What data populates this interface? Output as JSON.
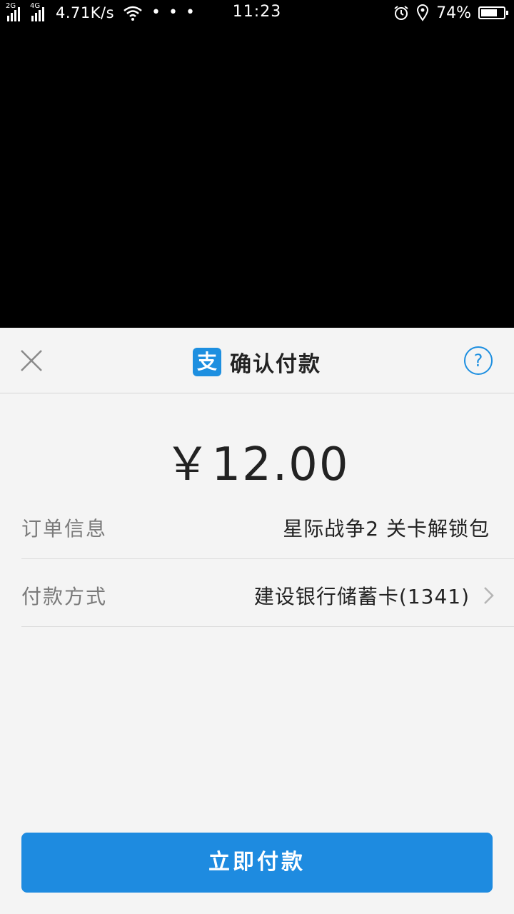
{
  "status_bar": {
    "sim1_tag": "2G",
    "sim2_tag": "4G",
    "net_speed": "4.71K/s",
    "more_dots": "• • •",
    "time": "11:23",
    "battery_text": "74%",
    "battery_level": 0.74,
    "icons": [
      "signal-icon",
      "signal-icon",
      "wifi-icon",
      "alarm-icon",
      "location-icon",
      "battery-icon"
    ]
  },
  "sheet": {
    "logo_char": "支",
    "title": "确认付款",
    "help_char": "?",
    "amount": "￥12.00",
    "order_label": "订单信息",
    "order_value": "星际战争2 关卡解锁包",
    "payment_label": "付款方式",
    "payment_value": "建设银行储蓄卡(1341)",
    "pay_button": "立即付款"
  },
  "colors": {
    "accent": "#1e8be0",
    "sheet_bg": "#f4f4f4",
    "overlay": "#000000"
  }
}
